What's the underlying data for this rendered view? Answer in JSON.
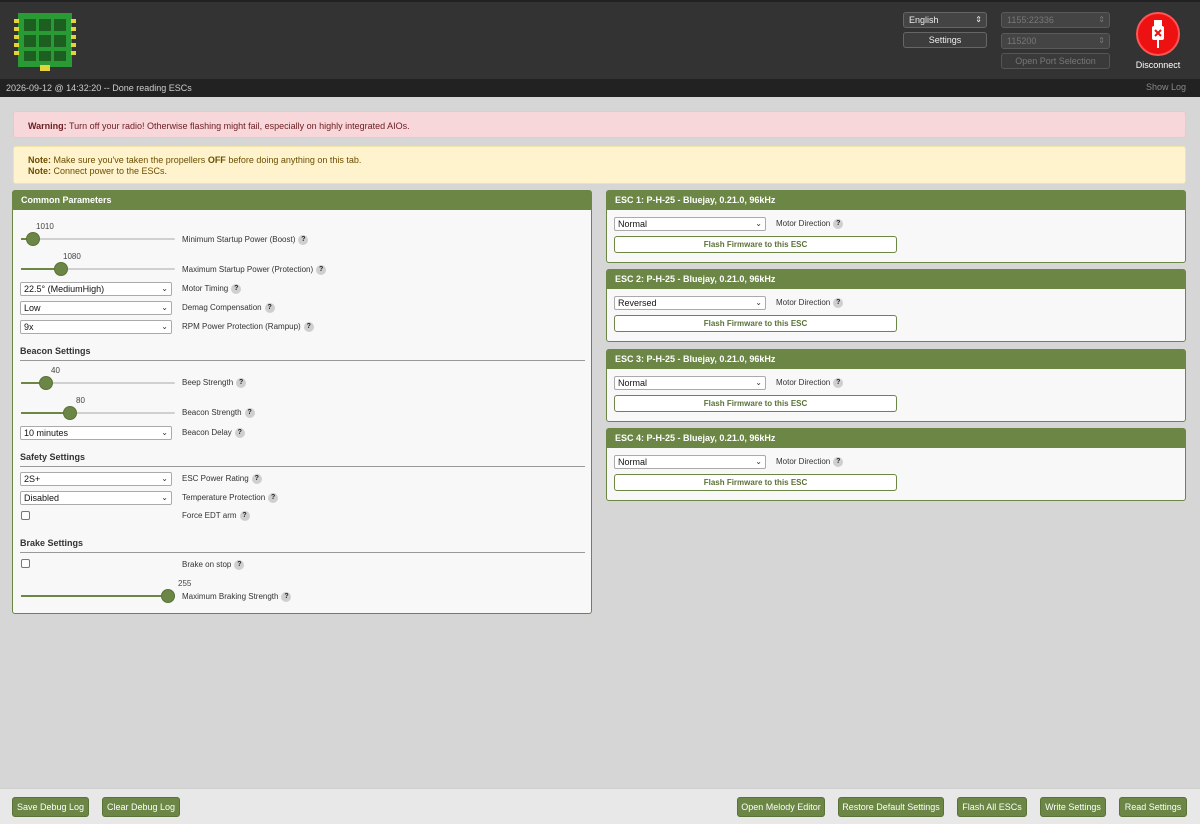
{
  "header": {
    "language": "English",
    "port": "1155:22336",
    "baud": "115200",
    "settings_label": "Settings",
    "open_port_label": "Open Port Selection",
    "disconnect_label": "Disconnect"
  },
  "log": {
    "text": "2026-09-12 @ 14:32:20 -- Done reading ESCs",
    "show_log": "Show Log"
  },
  "alerts": {
    "warning_bold": "Warning:",
    "warning_text": " Turn off your radio! Otherwise flashing might fail, especially on highly integrated AIOs.",
    "note1_bold": "Note:",
    "note1_text_a": " Make sure you've taken the propellers ",
    "note1_off": "OFF",
    "note1_text_b": " before doing anything on this tab.",
    "note2_bold": "Note:",
    "note2_text": " Connect power to the ESCs."
  },
  "common": {
    "title": "Common Parameters",
    "min_startup": {
      "value": "1010",
      "label": "Minimum Startup Power (Boost)",
      "fraction": 0.08
    },
    "max_startup": {
      "value": "1080",
      "label": "Maximum Startup Power (Protection)",
      "fraction": 0.26
    },
    "motor_timing": {
      "value": "22.5° (MediumHigh)",
      "label": "Motor Timing"
    },
    "demag": {
      "value": "Low",
      "label": "Demag Compensation"
    },
    "rpm_protection": {
      "value": "9x",
      "label": "RPM Power Protection (Rampup)"
    },
    "beacon": {
      "title": "Beacon Settings",
      "beep_strength": {
        "value": "40",
        "label": "Beep Strength",
        "fraction": 0.16
      },
      "beacon_strength": {
        "value": "80",
        "label": "Beacon Strength",
        "fraction": 0.32
      },
      "beacon_delay": {
        "value": "10 minutes",
        "label": "Beacon Delay"
      }
    },
    "safety": {
      "title": "Safety Settings",
      "power_rating": {
        "value": "2S+",
        "label": "ESC Power Rating"
      },
      "temp_protection": {
        "value": "Disabled",
        "label": "Temperature Protection"
      },
      "force_edt": {
        "label": "Force EDT arm",
        "checked": false
      }
    },
    "brake": {
      "title": "Brake Settings",
      "brake_on_stop": {
        "label": "Brake on stop",
        "checked": false
      },
      "max_braking": {
        "value": "255",
        "label": "Maximum Braking Strength",
        "fraction": 1.0
      }
    }
  },
  "escs": [
    {
      "title": "ESC 1: P-H-25 - Bluejay, 0.21.0, 96kHz",
      "direction": "Normal",
      "direction_label": "Motor Direction",
      "flash_label": "Flash Firmware to this ESC"
    },
    {
      "title": "ESC 2: P-H-25 - Bluejay, 0.21.0, 96kHz",
      "direction": "Reversed",
      "direction_label": "Motor Direction",
      "flash_label": "Flash Firmware to this ESC"
    },
    {
      "title": "ESC 3: P-H-25 - Bluejay, 0.21.0, 96kHz",
      "direction": "Normal",
      "direction_label": "Motor Direction",
      "flash_label": "Flash Firmware to this ESC"
    },
    {
      "title": "ESC 4: P-H-25 - Bluejay, 0.21.0, 96kHz",
      "direction": "Normal",
      "direction_label": "Motor Direction",
      "flash_label": "Flash Firmware to this ESC"
    }
  ],
  "footer": {
    "save_debug": "Save Debug Log",
    "clear_debug": "Clear Debug Log",
    "melody": "Open Melody Editor",
    "restore": "Restore Default Settings",
    "flash_all": "Flash All ESCs",
    "write": "Write Settings",
    "read": "Read Settings"
  },
  "help_glyph": "?",
  "colors": {
    "accent": "#6b8645",
    "header": "#333333",
    "disconnect": "#ee1111"
  },
  "icons": {
    "logo": "esc-board-icon",
    "disconnect": "usb-disconnect-icon",
    "help": "help-icon"
  }
}
